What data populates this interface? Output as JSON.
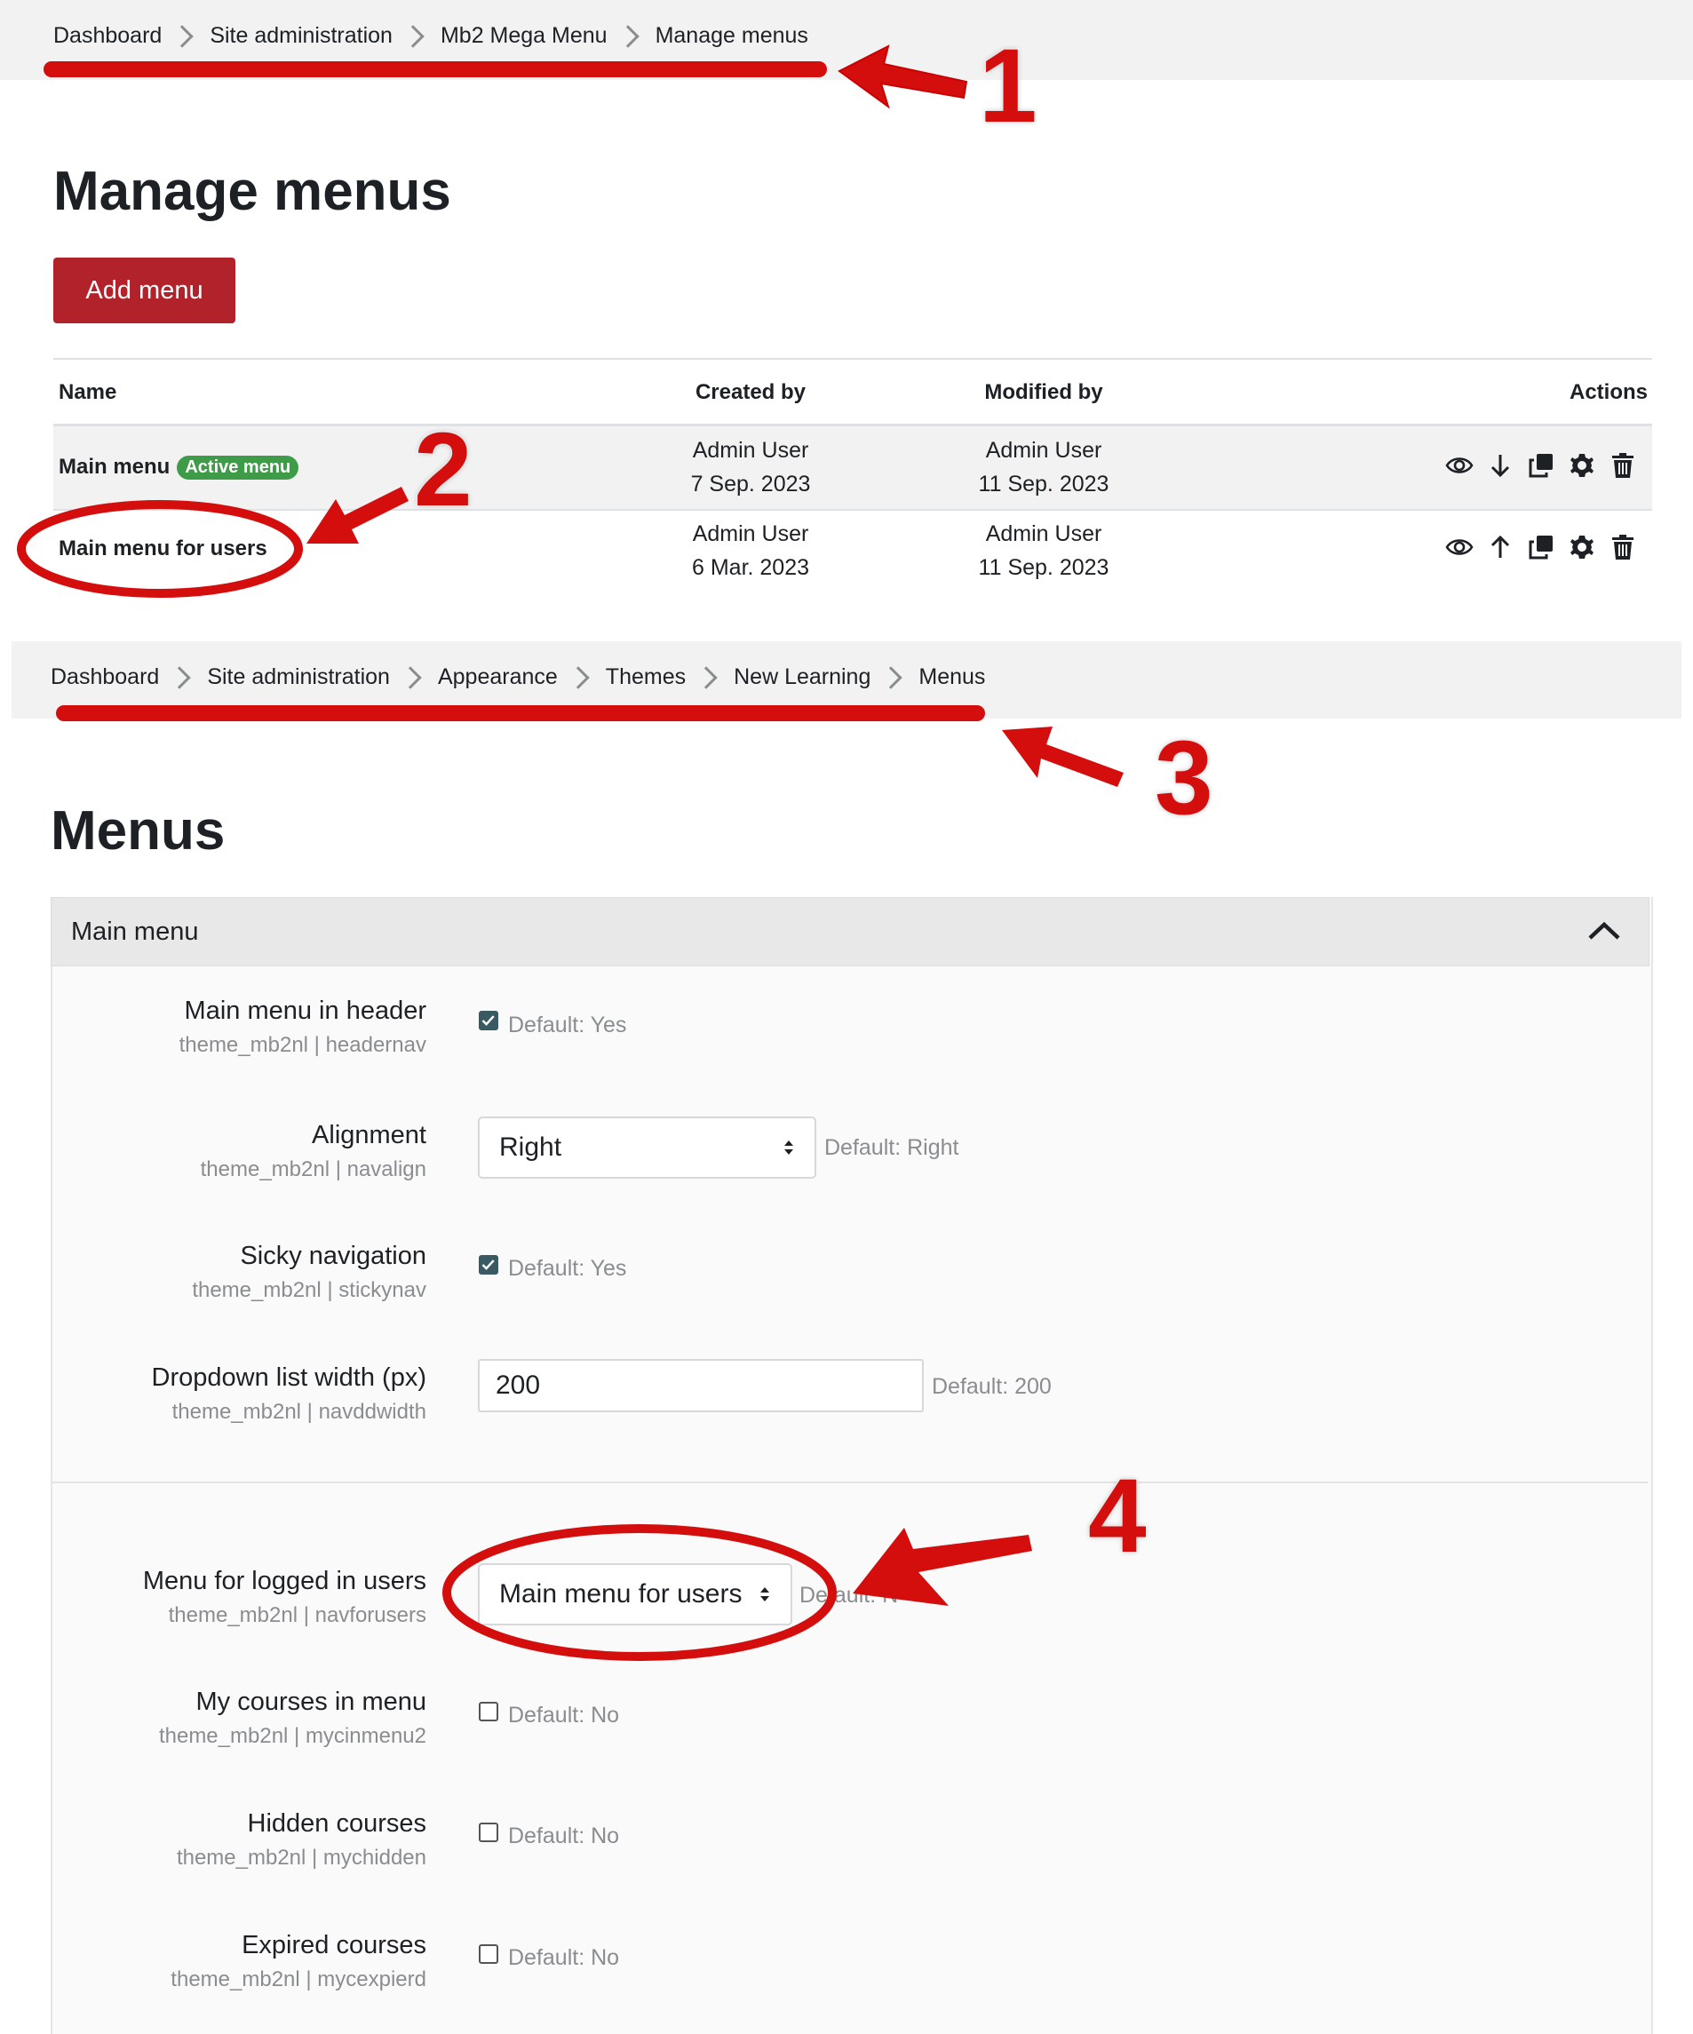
{
  "breadcrumb1": [
    "Dashboard",
    "Site administration",
    "Mb2 Mega Menu",
    "Manage menus"
  ],
  "page1": {
    "title": "Manage menus",
    "add_button": "Add menu"
  },
  "table": {
    "headers": {
      "name": "Name",
      "created": "Created by",
      "modified": "Modified by",
      "actions": "Actions"
    },
    "rows": [
      {
        "name": "Main menu",
        "badge": "Active menu",
        "created_user": "Admin User",
        "created_date": "7 Sep. 2023",
        "modified_user": "Admin User",
        "modified_date": "11 Sep. 2023",
        "move_icon": "arrow-down-icon"
      },
      {
        "name": "Main menu for users",
        "badge": "",
        "created_user": "Admin User",
        "created_date": "6 Mar. 2023",
        "modified_user": "Admin User",
        "modified_date": "11 Sep. 2023",
        "move_icon": "arrow-up-icon"
      }
    ]
  },
  "breadcrumb2": [
    "Dashboard",
    "Site administration",
    "Appearance",
    "Themes",
    "New Learning",
    "Menus"
  ],
  "page2": {
    "title": "Menus",
    "section_title": "Main menu"
  },
  "settings": [
    {
      "label": "Main menu in header",
      "sub": "theme_mb2nl | headernav",
      "control": "checkbox",
      "checked": true,
      "default": "Default: Yes"
    },
    {
      "label": "Alignment",
      "sub": "theme_mb2nl | navalign",
      "control": "select",
      "value": "Right",
      "default": "Default: Right"
    },
    {
      "label": "Sicky navigation",
      "sub": "theme_mb2nl | stickynav",
      "control": "checkbox",
      "checked": true,
      "default": "Default: Yes"
    },
    {
      "label": "Dropdown list width (px)",
      "sub": "theme_mb2nl | navddwidth",
      "control": "text",
      "value": "200",
      "default": "Default: 200"
    },
    {
      "label": "Menu for logged in users",
      "sub": "theme_mb2nl | navforusers",
      "control": "select",
      "value": "Main menu for users",
      "default": "Default: N"
    },
    {
      "label": "My courses in menu",
      "sub": "theme_mb2nl | mycinmenu2",
      "control": "checkbox",
      "checked": false,
      "default": "Default: No"
    },
    {
      "label": "Hidden courses",
      "sub": "theme_mb2nl | mychidden",
      "control": "checkbox",
      "checked": false,
      "default": "Default: No"
    },
    {
      "label": "Expired courses",
      "sub": "theme_mb2nl | mycexpierd",
      "control": "checkbox",
      "checked": false,
      "default": "Default: No"
    }
  ],
  "annotations": [
    "1",
    "2",
    "3",
    "4"
  ],
  "colors": {
    "accent": "#b2222a",
    "badge": "#3e9b48",
    "annotation": "#d40d0d",
    "checkbox": "#3a5a63"
  }
}
